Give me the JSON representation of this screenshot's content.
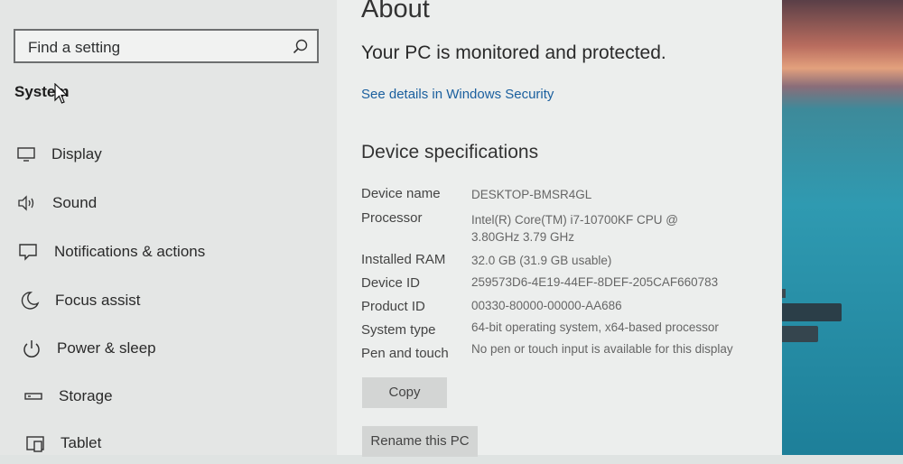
{
  "search": {
    "placeholder": "Find a setting"
  },
  "sidebar": {
    "section_title": "System",
    "items": [
      {
        "label": "Display",
        "icon": "display-icon"
      },
      {
        "label": "Sound",
        "icon": "sound-icon"
      },
      {
        "label": "Notifications & actions",
        "icon": "notifications-icon"
      },
      {
        "label": "Focus assist",
        "icon": "moon-icon"
      },
      {
        "label": "Power & sleep",
        "icon": "power-icon"
      },
      {
        "label": "Storage",
        "icon": "storage-icon"
      },
      {
        "label": "Tablet",
        "icon": "tablet-icon"
      }
    ]
  },
  "main": {
    "title": "About",
    "protection_status": "Your PC is monitored and protected.",
    "security_link": "See details in Windows Security",
    "specs_title": "Device specifications",
    "specs": [
      {
        "label": "Device name",
        "value": "DESKTOP-BMSR4GL"
      },
      {
        "label": "Processor",
        "value": "Intel(R) Core(TM) i7-10700KF CPU @ 3.80GHz   3.79 GHz"
      },
      {
        "label": "Installed RAM",
        "value": "32.0 GB (31.9 GB usable)"
      },
      {
        "label": "Device ID",
        "value": "259573D6-4E19-44EF-8DEF-205CAF660783"
      },
      {
        "label": "Product ID",
        "value": "00330-80000-00000-AA686"
      },
      {
        "label": "System type",
        "value": "64-bit operating system, x64-based processor"
      },
      {
        "label": "Pen and touch",
        "value": "No pen or touch input is available for this display"
      }
    ],
    "copy_button": "Copy",
    "rename_button": "Rename this PC"
  },
  "colors": {
    "link": "#1a5f9e",
    "button": "#d3d5d4",
    "sidebar_bg": "#e4e6e5"
  }
}
